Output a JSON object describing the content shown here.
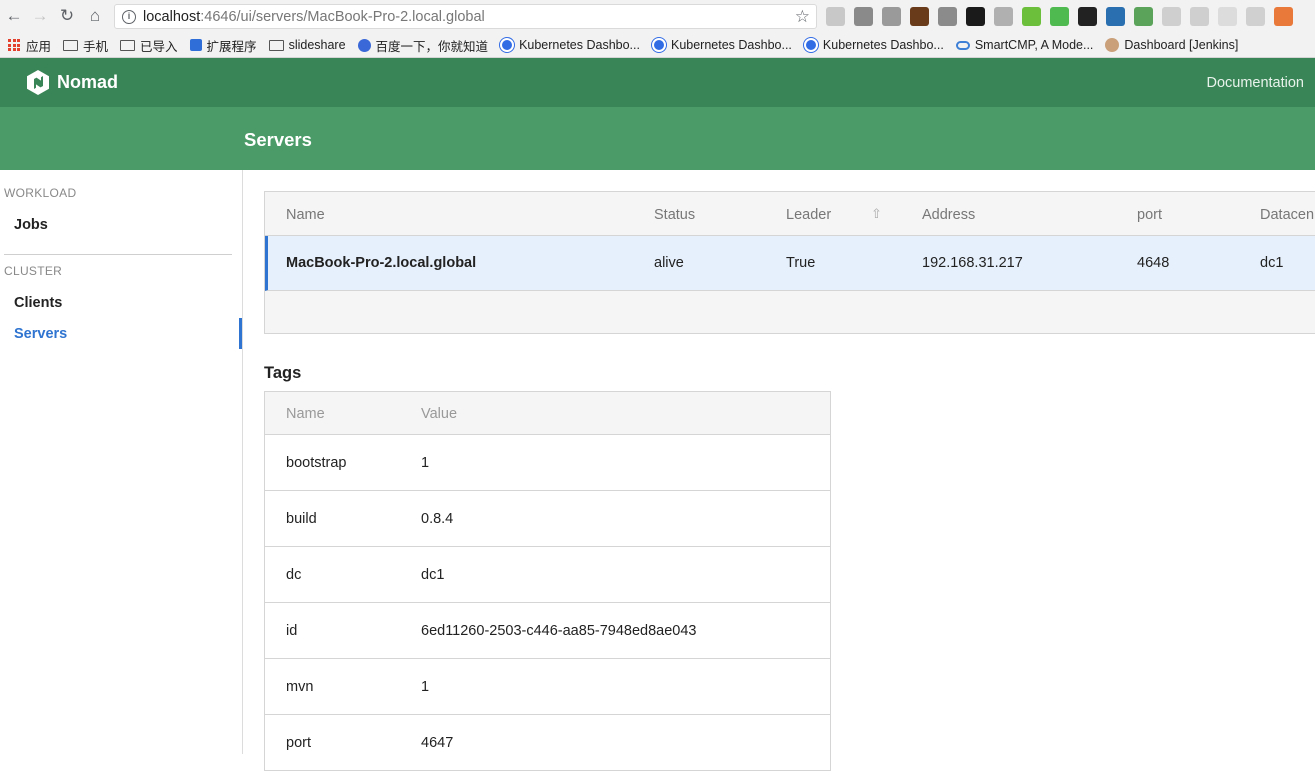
{
  "browser": {
    "url_host": "localhost",
    "url_path": ":4646/ui/servers/MacBook-Pro-2.local.global",
    "bookmarks": [
      {
        "label": "应用",
        "icon": "apps-grid-icon"
      },
      {
        "label": "手机",
        "icon": "folder-icon"
      },
      {
        "label": "已导入",
        "icon": "folder-icon"
      },
      {
        "label": "扩展程序",
        "icon": "puzzle-icon"
      },
      {
        "label": "slideshare",
        "icon": "folder-icon"
      },
      {
        "label": "百度一下，你就知道",
        "icon": "paw-icon"
      },
      {
        "label": "Kubernetes Dashbo...",
        "icon": "kubernetes-icon"
      },
      {
        "label": "Kubernetes Dashbo...",
        "icon": "kubernetes-icon"
      },
      {
        "label": "Kubernetes Dashbo...",
        "icon": "kubernetes-icon"
      },
      {
        "label": "SmartCMP, A Mode...",
        "icon": "smartcmp-icon"
      },
      {
        "label": "Dashboard [Jenkins]",
        "icon": "jenkins-icon"
      }
    ],
    "extensions": [
      "#c8c8c8",
      "#8a8a8a",
      "#9a9a9a",
      "#6a3b1a",
      "#8b8b8b",
      "#1a1a1a",
      "#b0b0b0",
      "#6cbf3a",
      "#4fba4f",
      "#222222",
      "#2a6fb0",
      "#5ba35b",
      "#cfcfcf",
      "#cfcfcf",
      "#dcdcdc",
      "#d0d0d0",
      "#e8793a"
    ]
  },
  "app": {
    "brand": "Nomad",
    "documentation_link": "Documentation",
    "page_title": "Servers"
  },
  "sidebar": {
    "workload_label": "WORKLOAD",
    "jobs": "Jobs",
    "cluster_label": "CLUSTER",
    "clients": "Clients",
    "servers": "Servers"
  },
  "servers_table": {
    "headers": {
      "name": "Name",
      "status": "Status",
      "leader": "Leader",
      "address": "Address",
      "port": "port",
      "datacenter": "Datacen"
    },
    "rows": [
      {
        "name": "MacBook-Pro-2.local.global",
        "status": "alive",
        "leader": "True",
        "address": "192.168.31.217",
        "port": "4648",
        "datacenter": "dc1"
      }
    ]
  },
  "tags": {
    "title": "Tags",
    "headers": {
      "name": "Name",
      "value": "Value"
    },
    "rows": [
      {
        "name": "bootstrap",
        "value": "1"
      },
      {
        "name": "build",
        "value": "0.8.4"
      },
      {
        "name": "dc",
        "value": "dc1"
      },
      {
        "name": "id",
        "value": "6ed11260-2503-c446-aa85-7948ed8ae043"
      },
      {
        "name": "mvn",
        "value": "1"
      },
      {
        "name": "port",
        "value": "4647"
      }
    ]
  }
}
